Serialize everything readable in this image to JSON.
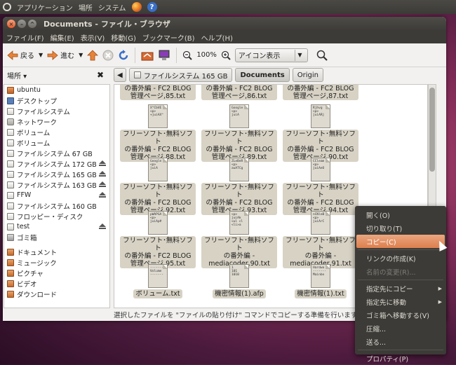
{
  "topbar": {
    "apps": "アプリケーション",
    "places": "場所",
    "system": "システム",
    "help": "?"
  },
  "window": {
    "title": "Documents - ファイル・ブラウザ"
  },
  "menubar": [
    "ファイル(F)",
    "編集(E)",
    "表示(V)",
    "移動(G)",
    "ブックマーク(B)",
    "ヘルプ(H)"
  ],
  "toolbar": {
    "back": "戻る",
    "forward": "進む",
    "zoom": "100%",
    "view_mode": "アイコン表示"
  },
  "sidebar": {
    "header": "場所 ▾",
    "items": [
      {
        "label": "ubuntu",
        "icon": "home-icon"
      },
      {
        "label": "デスクトップ",
        "icon": "desktop-icon"
      },
      {
        "label": "ファイルシステム",
        "icon": "drive-icon"
      },
      {
        "label": "ネットワーク",
        "icon": "network-icon"
      },
      {
        "label": "ボリューム",
        "icon": "drive-icon"
      },
      {
        "label": "ボリューム",
        "icon": "drive-icon"
      },
      {
        "label": "ファイルシステム 67 GB",
        "icon": "drive-icon"
      },
      {
        "label": "ファイルシステム 172 GB",
        "icon": "drive-icon",
        "eject": true
      },
      {
        "label": "ファイルシステム 165 GB",
        "icon": "drive-icon",
        "eject": true
      },
      {
        "label": "ファイルシステム 163 GB",
        "icon": "drive-icon",
        "eject": true
      },
      {
        "label": "FFW",
        "icon": "drive-icon",
        "eject": true
      },
      {
        "label": "ファイルシステム 160 GB",
        "icon": "drive-icon"
      },
      {
        "label": "フロッピー・ディスク",
        "icon": "floppy-icon"
      },
      {
        "label": "test",
        "icon": "drive-icon",
        "eject": true
      },
      {
        "label": "ゴミ箱",
        "icon": "trash-icon"
      },
      {
        "label": "ドキュメント",
        "icon": "folder-icon"
      },
      {
        "label": "ミュージック",
        "icon": "folder-icon"
      },
      {
        "label": "ピクチャ",
        "icon": "folder-icon"
      },
      {
        "label": "ビデオ",
        "icon": "folder-icon"
      },
      {
        "label": "ダウンロード",
        "icon": "folder-icon"
      }
    ]
  },
  "location": {
    "segments": [
      "ファイルシステム 165 GB",
      "Documents",
      "Origin"
    ]
  },
  "files": {
    "partial_top": [
      "の番外編 - FC2 BLOG\n管理ページ,85.txt",
      "の番外編 - FC2 BLOG\n管理ページ,86.txt",
      "の番外編 - FC2 BLOG\n管理ページ,87.txt"
    ],
    "items": [
      {
        "preview": "X^CbVE\n<p>\n+juiAX^",
        "label": "フリーソフト･無料ソフト\nの番外編 - FC2 BLOG\n管理ページ,88.txt"
      },
      {
        "preview": "Google\n<p>\njuiA",
        "label": "フリーソフト･無料ソフト\nの番外編 - FC2 BLOG\n管理ページ,89.txt"
      },
      {
        "preview": "Rjhvg\n<p>\njuiARj",
        "label": "フリーソフト･無料ソフト\nの番外編 - FC2 BLOG\n管理ページ,90.txt"
      },
      {
        "preview": "Google\n<p>\njuiA",
        "label": "フリーソフト･無料ソフト\nの番外編 - FC2 BLOG\n管理ページ,92.txt"
      },
      {
        "preview": "ZLeBeR\n<p>\nauATCg",
        "label": "フリーソフト･無料ソフト\nの番外編 - FC2 BLOG\n管理ページ,93.txt"
      },
      {
        "preview": "CCleam\n<p>\njuiAeO",
        "label": "フリーソフト･無料ソフト\nの番外編 - FC2 BLOG\n管理ページ,94.txt"
      },
      {
        "preview": "pWAPGA\n<p>\njuiAp#",
        "label": "フリーソフト･無料ソフト\nの番外編 - FC2 BLOG\n管理ページ,95.txt"
      },
      {
        "preview": "<p>\njuiAk\n<ul cl\n<li>a",
        "label": "フリーソフト･無料ソフト\nの番外編 -\nmediacoder,90.txt"
      },
      {
        "preview": "nCNleB\n<p>\njuiArC",
        "label": "フリーソフト･無料ソフト\nの番外編 -\nmediacoder,91.txt"
      },
      {
        "preview": "-------\nVolume\n-------",
        "label": "ボリューム.txt"
      },
      {
        "preview": "1\n101\n1010",
        "label": "機密情報(1).afp"
      },
      {
        "preview": "Hardwa\n-------\nMainbo",
        "label": "機密情報(1).txt"
      }
    ]
  },
  "status": "選択したファイルを \"ファイルの貼り付け\" コマンドでコピーする準備を行います",
  "context_menu": [
    {
      "label": "開く(O)"
    },
    {
      "label": "切り取り(T)"
    },
    {
      "label": "コピー(C)",
      "highlight": true
    },
    {
      "label": "リンクの作成(K)"
    },
    {
      "label": "名前の変更(R)...",
      "disabled": true
    },
    {
      "label": "指定先にコピー",
      "submenu": true
    },
    {
      "label": "指定先に移動",
      "submenu": true
    },
    {
      "label": "ゴミ箱へ移動する(V)"
    },
    {
      "label": "圧縮..."
    },
    {
      "label": "送る..."
    },
    {
      "label": "プロパティ(P)"
    }
  ]
}
